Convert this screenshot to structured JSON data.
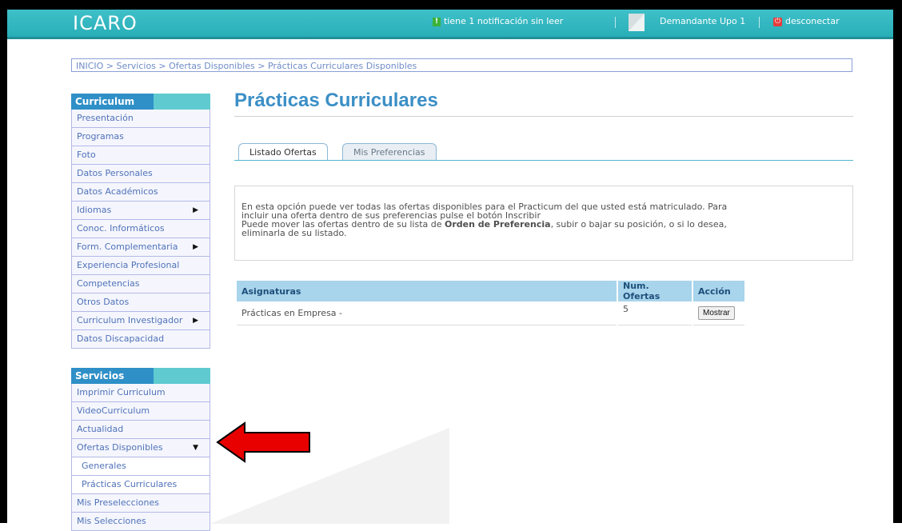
{
  "header": {
    "logo": "ICARO",
    "notification": "tiene 1 notificación sin leer",
    "user": "Demandante Upo 1",
    "logout": "desconectar"
  },
  "breadcrumb": "INICIO > Servicios > Ofertas Disponibles > Prácticas Curriculares Disponibles",
  "curriculum": {
    "title": "Curriculum",
    "items": [
      {
        "label": "Presentación",
        "arrow": ""
      },
      {
        "label": "Programas",
        "arrow": ""
      },
      {
        "label": "Foto",
        "arrow": ""
      },
      {
        "label": "Datos Personales",
        "arrow": ""
      },
      {
        "label": "Datos Académicos",
        "arrow": ""
      },
      {
        "label": "Idiomas",
        "arrow": "▶"
      },
      {
        "label": "Conoc. Informáticos",
        "arrow": ""
      },
      {
        "label": "Form. Complementaria",
        "arrow": "▶"
      },
      {
        "label": "Experiencia Profesional",
        "arrow": ""
      },
      {
        "label": "Competencias",
        "arrow": ""
      },
      {
        "label": "Otros Datos",
        "arrow": ""
      },
      {
        "label": "Curriculum Investigador",
        "arrow": "▶"
      },
      {
        "label": "Datos Discapacidad",
        "arrow": ""
      }
    ]
  },
  "servicios": {
    "title": "Servicios",
    "items": [
      {
        "label": "Imprimir Curriculum",
        "arrow": ""
      },
      {
        "label": "VideoCurriculum",
        "arrow": ""
      },
      {
        "label": "Actualidad",
        "arrow": ""
      },
      {
        "label": "Ofertas Disponibles",
        "arrow": "▼"
      },
      {
        "label": "Generales",
        "arrow": ""
      },
      {
        "label": "Prácticas Curriculares",
        "arrow": ""
      },
      {
        "label": "Mis Preselecciones",
        "arrow": ""
      },
      {
        "label": "Mis Selecciones",
        "arrow": ""
      }
    ]
  },
  "main": {
    "title": "Prácticas Curriculares",
    "tabs": [
      "Listado Ofertas",
      "Mis Preferencias"
    ],
    "info_line1": "En esta opción puede ver todas las ofertas disponibles para el Practicum del que usted está matriculado. Para",
    "info_line2": "incluir una oferta dentro de sus preferencias pulse el botón Inscribir",
    "info_line3_pre": "Puede mover las ofertas dentro de su lista de ",
    "info_line3_bold": "Orden de Preferencia",
    "info_line3_post": ", subir o bajar su posición, o si lo desea,",
    "info_line4": "eliminarla de su listado.",
    "table": {
      "headers": [
        "Asignaturas",
        "Num. Ofertas",
        "Acción"
      ],
      "rows": [
        {
          "asignatura": "Prácticas en Empresa -",
          "num": "5",
          "accion": "Mostrar"
        }
      ]
    }
  },
  "colors": {
    "topbar": "#29aeb8",
    "menu_header": "#2f8fc7",
    "title": "#3b8fc6",
    "arrow": "#e00000"
  }
}
